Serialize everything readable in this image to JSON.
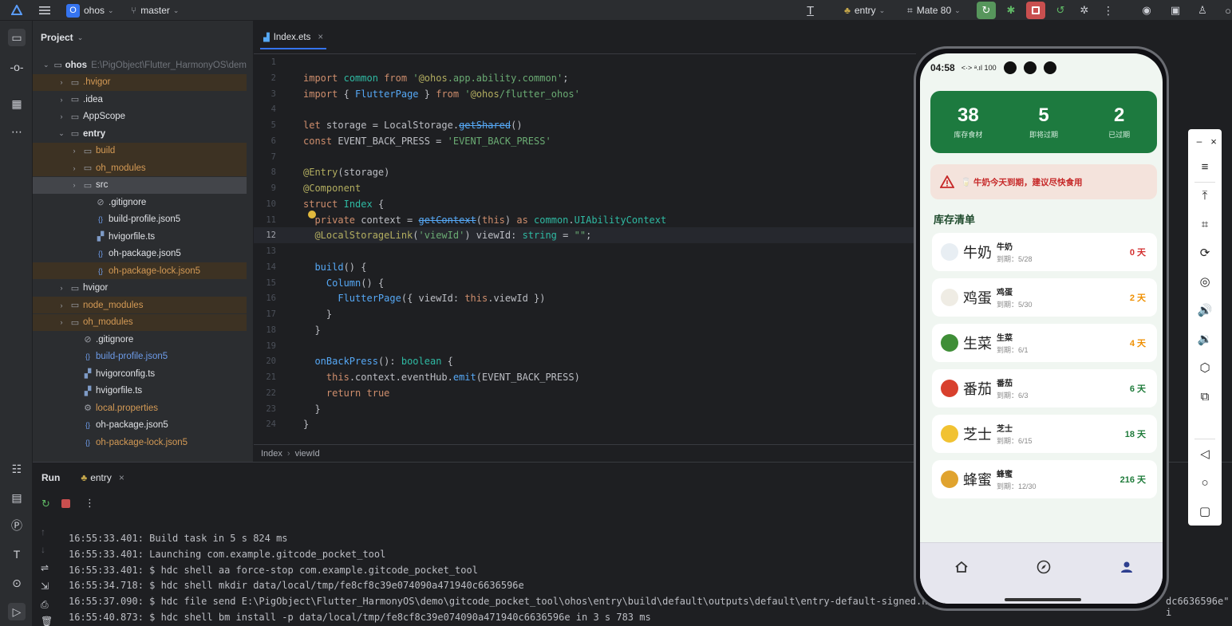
{
  "toolbar": {
    "project_badge": "O",
    "project_name": "ohos",
    "branch": "master",
    "run_config": "entry",
    "device": "Mate 80"
  },
  "project_panel": {
    "title": "Project",
    "tree": [
      {
        "label": "ohos",
        "path": "E:\\PigObject\\Flutter_HarmonyOS\\dem",
        "type": "folder",
        "expanded": true,
        "bold": true,
        "excluded": false,
        "depth": 0
      },
      {
        "label": ".hvigor",
        "type": "folder",
        "expanded": false,
        "excluded": true,
        "depth": 1
      },
      {
        "label": ".idea",
        "type": "folder",
        "expanded": false,
        "excluded": false,
        "depth": 1
      },
      {
        "label": "AppScope",
        "type": "folder",
        "expanded": false,
        "excluded": false,
        "depth": 1
      },
      {
        "label": "entry",
        "type": "folder",
        "expanded": true,
        "bold": true,
        "excluded": false,
        "depth": 1
      },
      {
        "label": "build",
        "type": "folder",
        "expanded": false,
        "excluded": true,
        "depth": 2
      },
      {
        "label": "oh_modules",
        "type": "folder",
        "expanded": false,
        "excluded": true,
        "depth": 2
      },
      {
        "label": "src",
        "type": "folder",
        "expanded": false,
        "excluded": false,
        "selected": true,
        "depth": 2
      },
      {
        "label": ".gitignore",
        "type": "ignore",
        "excluded": false,
        "depth": 3
      },
      {
        "label": "build-profile.json5",
        "type": "json",
        "excluded": false,
        "depth": 3
      },
      {
        "label": "hvigorfile.ts",
        "type": "ts",
        "excluded": false,
        "depth": 3
      },
      {
        "label": "oh-package.json5",
        "type": "json",
        "excluded": false,
        "depth": 3
      },
      {
        "label": "oh-package-lock.json5",
        "type": "json",
        "excluded": true,
        "depth": 3
      },
      {
        "label": "hvigor",
        "type": "folder",
        "expanded": false,
        "excluded": false,
        "depth": 1
      },
      {
        "label": "node_modules",
        "type": "folder",
        "expanded": false,
        "excluded": true,
        "depth": 1
      },
      {
        "label": "oh_modules",
        "type": "folder",
        "expanded": false,
        "excluded": true,
        "depth": 1
      },
      {
        "label": ".gitignore",
        "type": "ignore",
        "excluded": false,
        "depth": 2
      },
      {
        "label": "build-profile.json5",
        "type": "json",
        "color": "blue",
        "excluded": false,
        "depth": 2
      },
      {
        "label": "hvigorconfig.ts",
        "type": "ts",
        "excluded": false,
        "depth": 2
      },
      {
        "label": "hvigorfile.ts",
        "type": "ts",
        "excluded": false,
        "depth": 2
      },
      {
        "label": "local.properties",
        "type": "props",
        "excluded": false,
        "color": "orange",
        "depth": 2
      },
      {
        "label": "oh-package.json5",
        "type": "json",
        "excluded": false,
        "depth": 2
      },
      {
        "label": "oh-package-lock.json5",
        "type": "json",
        "excluded": false,
        "color": "orange",
        "depth": 2
      }
    ]
  },
  "editor": {
    "tab": "Index.ets",
    "current_line": 12,
    "lines": [
      "",
      "import common from '@ohos.app.ability.common';",
      "import { FlutterPage } from '@ohos/flutter_ohos'",
      "",
      "let storage = LocalStorage.getShared()",
      "const EVENT_BACK_PRESS = 'EVENT_BACK_PRESS'",
      "",
      "@Entry(storage)",
      "@Component",
      "struct Index {",
      "  private context = getContext(this) as common.UIAbilityContext",
      "  @LocalStorageLink('viewId') viewId: string = \"\";",
      "",
      "  build() {",
      "    Column() {",
      "      FlutterPage({ viewId: this.viewId })",
      "    }",
      "  }",
      "",
      "  onBackPress(): boolean {",
      "    this.context.eventHub.emit(EVENT_BACK_PRESS)",
      "    return true",
      "  }",
      "}"
    ],
    "breadcrumb": [
      "Index",
      "viewId"
    ]
  },
  "run_panel": {
    "title": "Run",
    "tab": "entry",
    "log": [
      "16:55:33.401: Build task in 5 s 824 ms",
      "16:55:33.401: Launching com.example.gitcode_pocket_tool",
      "16:55:33.401: $ hdc shell aa force-stop com.example.gitcode_pocket_tool",
      "16:55:34.718: $ hdc shell mkdir data/local/tmp/fe8cf8c39e074090a471940c6636596e",
      "16:55:37.090: $ hdc file send E:\\PigObject\\Flutter_HarmonyOS\\demo\\gitcode_pocket_tool\\ohos\\entry\\build\\default\\outputs\\default\\entry-default-signed.h",
      "16:55:40.873: $ hdc shell bm install -p data/local/tmp/fe8cf8c39e074090a471940c6636596e in 3 s 783 ms"
    ],
    "log_overflow_right": "dc6636596e\" i"
  },
  "phone": {
    "time": "04:58",
    "status_icons": "<·> ᵃ.ıl 100",
    "stats": [
      {
        "value": "38",
        "label": "库存食材"
      },
      {
        "value": "5",
        "label": "即将过期"
      },
      {
        "value": "2",
        "label": "已过期"
      }
    ],
    "alert_text": "🥛 牛奶今天到期，建议尽快食用",
    "section_title": "库存清单",
    "items": [
      {
        "emoji": "🥛",
        "big": "牛奶",
        "name": "牛奶",
        "date": "到期：5/28",
        "days": "0 天",
        "color": "#d32f2f"
      },
      {
        "emoji": "🥚",
        "big": "鸡蛋",
        "name": "鸡蛋",
        "date": "到期：5/30",
        "days": "2 天",
        "color": "#ef8f00"
      },
      {
        "emoji": "🥬",
        "big": "生菜",
        "name": "生菜",
        "date": "到期：6/1",
        "days": "4 天",
        "color": "#ef8f00"
      },
      {
        "emoji": "🍅",
        "big": "番茄",
        "name": "番茄",
        "date": "到期：6/3",
        "days": "6 天",
        "color": "#1e7b3a"
      },
      {
        "emoji": "🧀",
        "big": "芝士",
        "name": "芝士",
        "date": "到期：6/15",
        "days": "18 天",
        "color": "#1e7b3a"
      },
      {
        "emoji": "🍯",
        "big": "蜂蜜",
        "name": "蜂蜜",
        "date": "到期：12/30",
        "days": "216 天",
        "color": "#1e7b3a"
      }
    ],
    "colors": {
      "stats_bg": "#1d7a3f",
      "alert_bg": "#f4e3dc",
      "alert_text": "#c62828",
      "bg": "#f0f6f1"
    }
  }
}
